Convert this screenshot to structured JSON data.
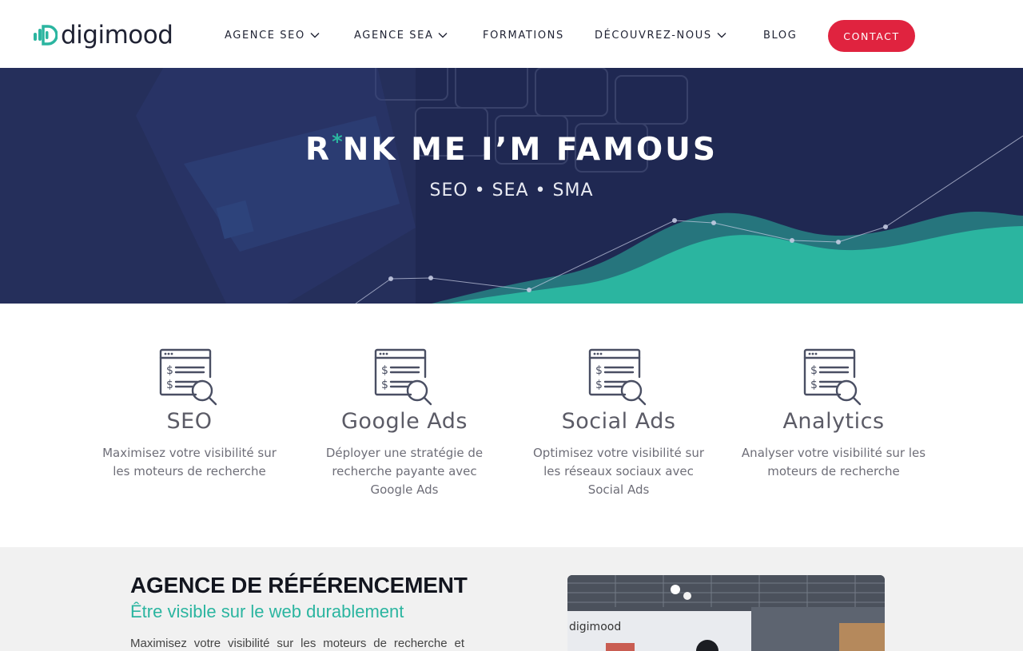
{
  "brand": {
    "name": "digimood",
    "accent": "#2bb5a0",
    "cta_color": "#e0233f",
    "dark": "#1f2233"
  },
  "nav": {
    "items": [
      {
        "label": "AGENCE SEO",
        "has_dropdown": true
      },
      {
        "label": "AGENCE SEA",
        "has_dropdown": true
      },
      {
        "label": "FORMATIONS",
        "has_dropdown": false
      },
      {
        "label": "DÉCOUVREZ-NOUS",
        "has_dropdown": true
      },
      {
        "label": "BLOG",
        "has_dropdown": false
      }
    ],
    "contact_label": "CONTACT"
  },
  "hero": {
    "title_start": "R",
    "title_star": "*",
    "title_end": "NK ME I’M FAMOUS",
    "subtitle": "SEO • SEA • SMA"
  },
  "services": [
    {
      "title": "SEO",
      "description": "Maximisez votre visibilité sur les moteurs de recherche",
      "icon": "seo-report-icon"
    },
    {
      "title": "Google Ads",
      "description": "Déployer une stratégie de recherche payante avec Google Ads",
      "icon": "seo-report-icon"
    },
    {
      "title": "Social Ads",
      "description": "Optimisez votre visibilité sur les réseaux sociaux avec Social Ads",
      "icon": "seo-report-icon"
    },
    {
      "title": "Analytics",
      "description": "Analyser votre visibilité sur les moteurs de recherche",
      "icon": "seo-report-icon"
    }
  ],
  "agence": {
    "title": "AGENCE DE RÉFÉRENCEMENT",
    "subtitle": "Être visible sur le web durablement",
    "text": "Maximisez votre visibilité sur les moteurs de recherche et",
    "photo_caption": "digimood"
  }
}
